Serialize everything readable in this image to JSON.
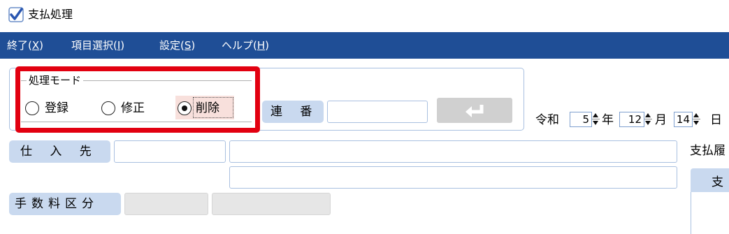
{
  "window": {
    "title": "支払処理",
    "icon": "checkmark-app-icon"
  },
  "menu": {
    "items": [
      {
        "label": "終了(",
        "key": "X",
        "close": ")"
      },
      {
        "label": "項目選択(",
        "key": "I",
        "close": ")"
      },
      {
        "label": "設定(",
        "key": "S",
        "close": ")"
      },
      {
        "label": "ヘルプ(",
        "key": "H",
        "close": ")"
      }
    ]
  },
  "mode": {
    "legend": "処理モード",
    "options": [
      {
        "label": "登録",
        "selected": false
      },
      {
        "label": "修正",
        "selected": false
      },
      {
        "label": "削除",
        "selected": true
      }
    ]
  },
  "serial": {
    "label": "連 番",
    "value": ""
  },
  "enter_button": {
    "icon": "enter-return-icon"
  },
  "date": {
    "era": "令和",
    "year": "5",
    "year_unit": "年",
    "month": "12",
    "month_unit": "月",
    "day": "14",
    "day_unit": "日"
  },
  "supplier": {
    "label": "仕 入 先",
    "code": "",
    "name1": "",
    "name2": ""
  },
  "fee_category": {
    "label": "手数料区分",
    "code": "",
    "name": ""
  },
  "right_panel": {
    "label": "支払履",
    "header": "支"
  },
  "colors": {
    "menubar": "#1f4e96",
    "highlight": "#e20010",
    "label_chip": "#c9d9ef"
  }
}
